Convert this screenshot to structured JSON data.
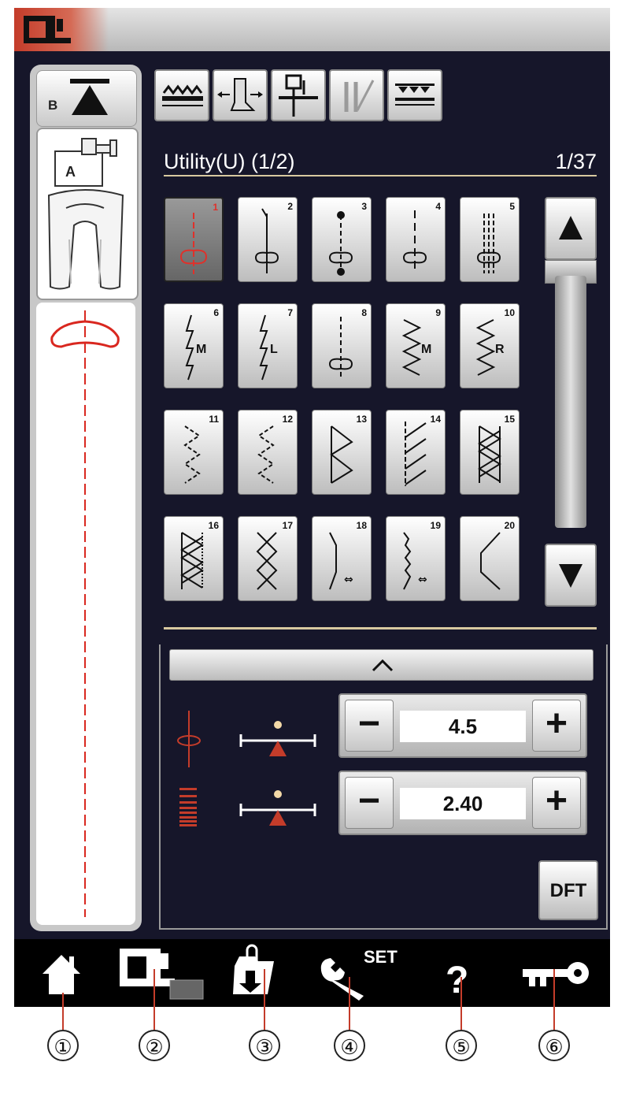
{
  "mode": {
    "title": "Utility(U) (1/2)",
    "counter": "1/37"
  },
  "left_panel": {
    "upper_foot_label": "B",
    "foot_label": "A"
  },
  "stitches": [
    {
      "num": "1",
      "selected": true
    },
    {
      "num": "2"
    },
    {
      "num": "3"
    },
    {
      "num": "4"
    },
    {
      "num": "5"
    },
    {
      "num": "6",
      "letter": "M"
    },
    {
      "num": "7",
      "letter": "L"
    },
    {
      "num": "8"
    },
    {
      "num": "9",
      "letter": "M"
    },
    {
      "num": "10",
      "letter": "R"
    },
    {
      "num": "11"
    },
    {
      "num": "12"
    },
    {
      "num": "13"
    },
    {
      "num": "14"
    },
    {
      "num": "15"
    },
    {
      "num": "16"
    },
    {
      "num": "17"
    },
    {
      "num": "18",
      "letter": "⇔"
    },
    {
      "num": "19",
      "letter": "⇔"
    },
    {
      "num": "20"
    }
  ],
  "settings": {
    "needle_position": {
      "value": "4.5",
      "minus": "−",
      "plus": "+"
    },
    "stitch_length": {
      "value": "2.40",
      "minus": "−",
      "plus": "+"
    },
    "default_label": "DFT"
  },
  "toolbar": {
    "set_label": "SET",
    "help_label": "?"
  },
  "callouts": [
    "①",
    "②",
    "③",
    "④",
    "⑤",
    "⑥"
  ],
  "colors": {
    "accent_red": "#c43c2a",
    "background": "#16162a",
    "gold_rule": "#d8c9a0"
  }
}
